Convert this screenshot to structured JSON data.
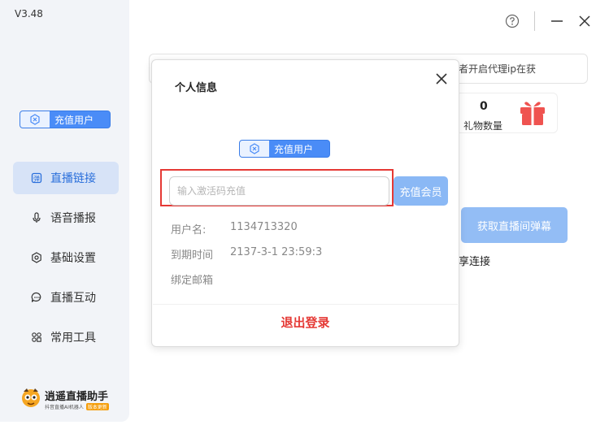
{
  "app": {
    "version": "V3.48"
  },
  "vip_badge": {
    "label": "充值用户"
  },
  "sidebar": {
    "items": [
      {
        "label": "直播链接",
        "icon": "live-link-icon",
        "active": true
      },
      {
        "label": "语音播报",
        "icon": "microphone-icon",
        "active": false
      },
      {
        "label": "基础设置",
        "icon": "gear-icon",
        "active": false
      },
      {
        "label": "直播互动",
        "icon": "chat-icon",
        "active": false
      },
      {
        "label": "常用工具",
        "icon": "tools-grid-icon",
        "active": false
      }
    ]
  },
  "logo": {
    "brand": "逍遥直播助手",
    "sub": "抖音直播AI机器人",
    "tag": "版本更新"
  },
  "background": {
    "proxy_hint": "者开启代理ip在获",
    "gift_count": "0",
    "gift_label": "礼物数量",
    "fetch_button": "获取直播间弹幕",
    "share_connect": "享连接"
  },
  "modal": {
    "title": "个人信息",
    "badge_label": "充值用户",
    "code_input": {
      "placeholder": "输入激活码充值",
      "value": ""
    },
    "recharge_button": "充值会员",
    "fields": [
      {
        "label": "用户名:",
        "value": "1134713320"
      },
      {
        "label": "到期时间",
        "value": "2137-3-1 23:59:3"
      },
      {
        "label": "绑定邮箱",
        "value": ""
      }
    ],
    "logout_button": "退出登录"
  },
  "colors": {
    "accent": "#4a8cf7",
    "danger": "#e53935",
    "active_nav_bg": "#d7e3f7"
  }
}
